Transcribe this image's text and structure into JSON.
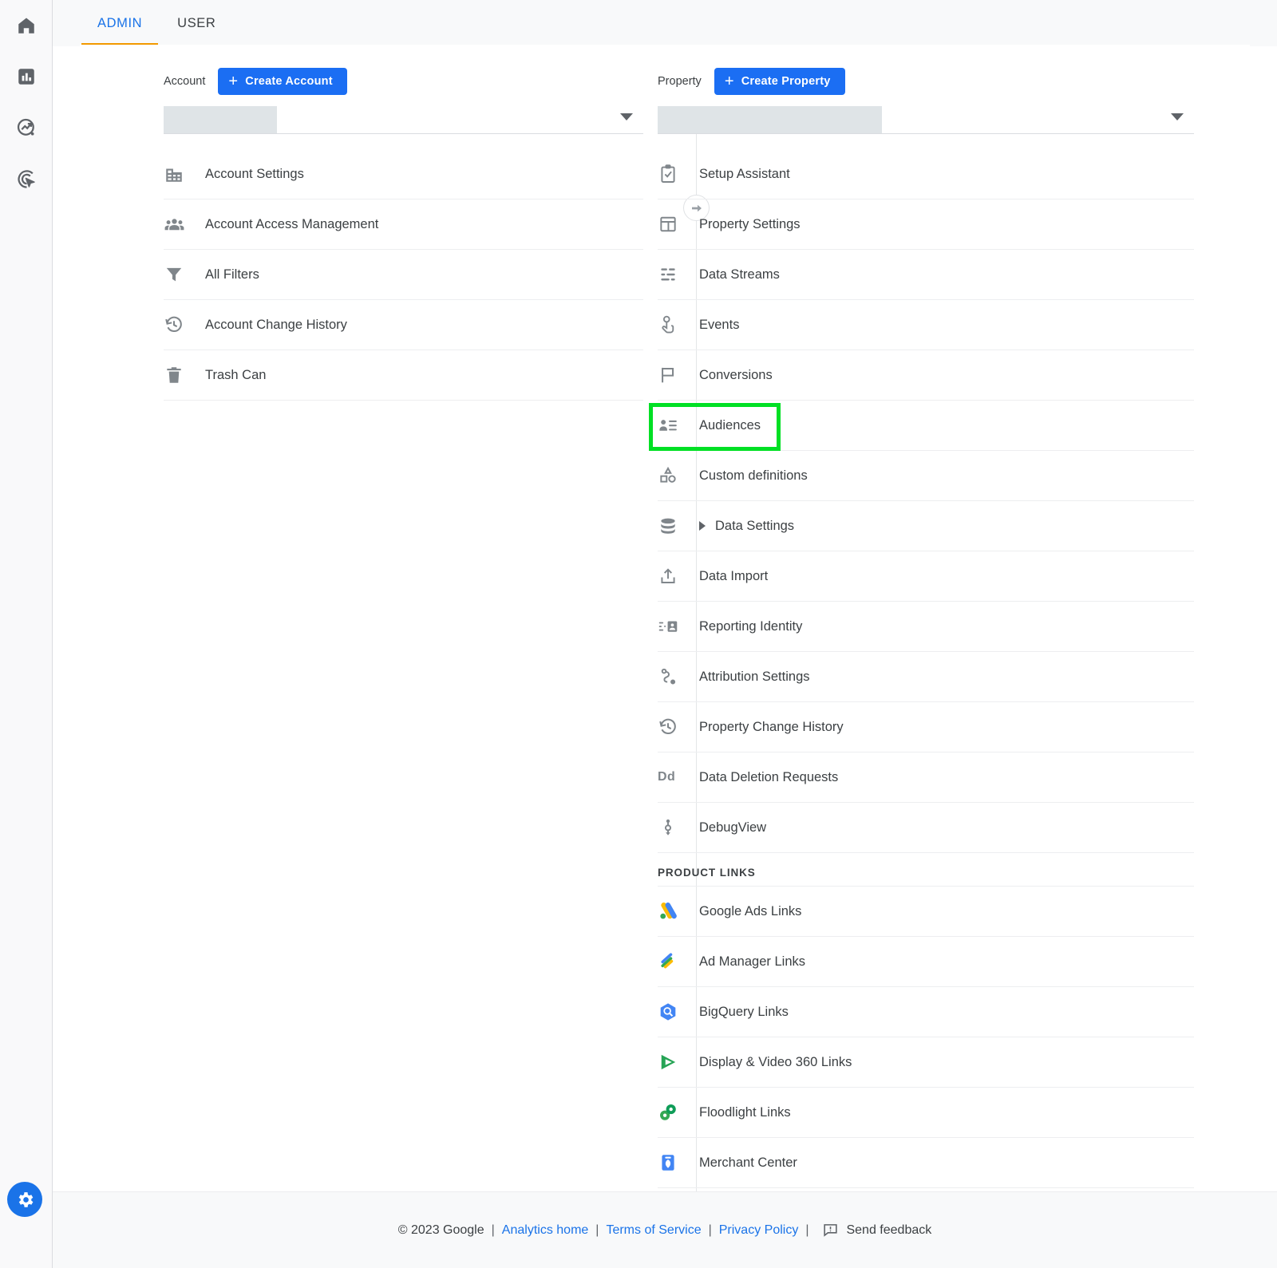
{
  "tabs": [
    {
      "label": "ADMIN",
      "active": true
    },
    {
      "label": "USER",
      "active": false
    }
  ],
  "rail": {
    "items": [
      {
        "icon": "home-icon",
        "name": "home"
      },
      {
        "icon": "reports-icon",
        "name": "reports"
      },
      {
        "icon": "explore-icon",
        "name": "explore"
      },
      {
        "icon": "advertising-icon",
        "name": "advertising"
      }
    ],
    "settings_icon": "gear-icon",
    "settings_color": "#1a73e8"
  },
  "account": {
    "label": "Account",
    "create_button": "Create Account",
    "selected_value": "",
    "items": [
      {
        "label": "Account Settings",
        "icon": "building-icon"
      },
      {
        "label": "Account Access Management",
        "icon": "people-icon"
      },
      {
        "label": "All Filters",
        "icon": "funnel-icon"
      },
      {
        "label": "Account Change History",
        "icon": "history-icon"
      },
      {
        "label": "Trash Can",
        "icon": "trash-icon"
      }
    ]
  },
  "property": {
    "label": "Property",
    "create_button": "Create Property",
    "selected_value": "",
    "items": [
      {
        "label": "Setup Assistant",
        "icon": "clipboard-check-icon"
      },
      {
        "label": "Property Settings",
        "icon": "layout-icon"
      },
      {
        "label": "Data Streams",
        "icon": "data-streams-icon"
      },
      {
        "label": "Events",
        "icon": "tap-icon"
      },
      {
        "label": "Conversions",
        "icon": "flag-icon"
      },
      {
        "label": "Audiences",
        "icon": "audience-icon",
        "highlighted": true
      },
      {
        "label": "Custom definitions",
        "icon": "shapes-icon"
      },
      {
        "label": "Data Settings",
        "icon": "database-icon",
        "expandable": true
      },
      {
        "label": "Data Import",
        "icon": "upload-icon"
      },
      {
        "label": "Reporting Identity",
        "icon": "reporting-identity-icon"
      },
      {
        "label": "Attribution Settings",
        "icon": "attribution-icon"
      },
      {
        "label": "Property Change History",
        "icon": "history-icon"
      },
      {
        "label": "Data Deletion Requests",
        "icon": "dd-icon"
      },
      {
        "label": "DebugView",
        "icon": "debugview-icon"
      }
    ],
    "product_links_header": "PRODUCT LINKS",
    "product_links": [
      {
        "label": "Google Ads Links",
        "icon": "google-ads-icon"
      },
      {
        "label": "Ad Manager Links",
        "icon": "ad-manager-icon"
      },
      {
        "label": "BigQuery Links",
        "icon": "bigquery-icon"
      },
      {
        "label": "Display & Video 360 Links",
        "icon": "dv360-icon"
      },
      {
        "label": "Floodlight Links",
        "icon": "floodlight-icon"
      },
      {
        "label": "Merchant Center",
        "icon": "merchant-center-icon"
      }
    ]
  },
  "highlight": {
    "color": "#00e024",
    "target": "Audiences"
  },
  "footer": {
    "copyright": "© 2023 Google",
    "links": [
      {
        "label": "Analytics home"
      },
      {
        "label": "Terms of Service"
      },
      {
        "label": "Privacy Policy"
      }
    ],
    "feedback": "Send feedback",
    "separator": "|"
  },
  "colors": {
    "accent_blue": "#1a73e8",
    "tab_underline": "#f29900",
    "highlight_green": "#00e024"
  }
}
